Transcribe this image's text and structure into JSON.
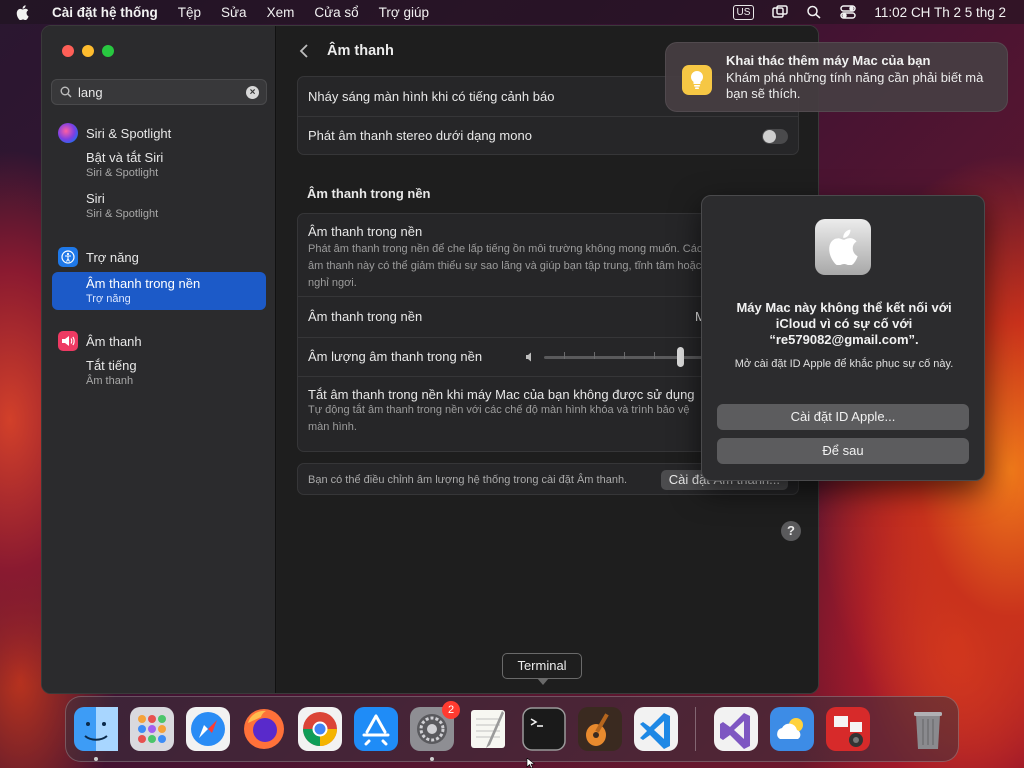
{
  "menubar": {
    "app_name": "Cài đặt hệ thống",
    "items": [
      "Tệp",
      "Sửa",
      "Xem",
      "Cửa sổ",
      "Trợ giúp"
    ],
    "input_source": "US",
    "clock": "11:02 CH Th 2 5 thg 2"
  },
  "sidebar": {
    "search": {
      "value": "lang"
    },
    "groups": [
      {
        "title": "Siri & Spotlight",
        "icon": "siri-icon",
        "items": [
          {
            "title": "Bật và tắt Siri",
            "subtitle": "Siri & Spotlight"
          },
          {
            "title": "Siri",
            "subtitle": "Siri & Spotlight"
          }
        ]
      },
      {
        "title": "Trợ năng",
        "icon": "accessibility-icon",
        "items": [
          {
            "title": "Âm thanh trong nền",
            "subtitle": "Trợ năng",
            "selected": true
          }
        ]
      },
      {
        "title": "Âm thanh",
        "icon": "speaker-icon",
        "items": [
          {
            "title": "Tắt tiếng",
            "subtitle": "Âm thanh"
          }
        ]
      }
    ]
  },
  "main": {
    "title": "Âm thanh",
    "top_rows": [
      {
        "label": "Nháy sáng màn hình khi có tiếng cảnh báo"
      },
      {
        "label": "Phát âm thanh stereo dưới dạng mono",
        "toggle": false
      }
    ],
    "bg_section_title": "Âm thanh trong nền",
    "bg_panel": {
      "heading": "Âm thanh trong nền",
      "description": "Phát âm thanh trong nền để che lấp tiếng ồn môi trường không mong muốn. Các âm thanh này có thể giảm thiểu sự sao lãng và giúp bạn tập trung, tĩnh tâm hoặc nghỉ ngơi.",
      "sound_label": "Âm thanh trong nền",
      "sound_value": "M",
      "volume_label": "Âm lượng âm thanh trong nền",
      "volume_level": 0.85,
      "mute_title": "Tắt âm thanh trong nền khi máy Mac của bạn không được sử dụng",
      "mute_desc": "Tự động tắt âm thanh trong nền với các chế độ màn hình khóa và trình bảo vệ màn hình."
    },
    "footer_text": "Bạn có thể điều chỉnh âm lượng hệ thống trong cài đặt Âm thanh.",
    "footer_button": "Cài đặt Âm thanh...",
    "help": "?"
  },
  "notification": {
    "title": "Khai thác thêm máy Mac của bạn",
    "body": "Khám phá những tính năng cần phải biết mà bạn sẽ thích."
  },
  "dialog": {
    "message": "Máy Mac này không thể kết nối với iCloud vì có sự cố với “re579082@gmail.com”.",
    "info": "Mở cài đặt ID Apple để khắc phục sự cố này.",
    "primary_button": "Cài đặt ID Apple...",
    "secondary_button": "Để sau"
  },
  "dock": {
    "tooltip": "Terminal",
    "apps": [
      {
        "name": "finder",
        "running": true
      },
      {
        "name": "launchpad"
      },
      {
        "name": "safari"
      },
      {
        "name": "firefox"
      },
      {
        "name": "chrome"
      },
      {
        "name": "app-store"
      },
      {
        "name": "system-settings",
        "badge": "2",
        "running": true
      },
      {
        "name": "textedit"
      },
      {
        "name": "terminal"
      },
      {
        "name": "garageband"
      },
      {
        "name": "vscode"
      },
      {
        "name": "visual-studio"
      },
      {
        "name": "weather"
      },
      {
        "name": "photo-booth"
      },
      {
        "name": "trash"
      }
    ]
  },
  "colors": {
    "accent": "#1c5ac8",
    "notif_icon": "#f6c744",
    "badge": "#ff3b30"
  }
}
